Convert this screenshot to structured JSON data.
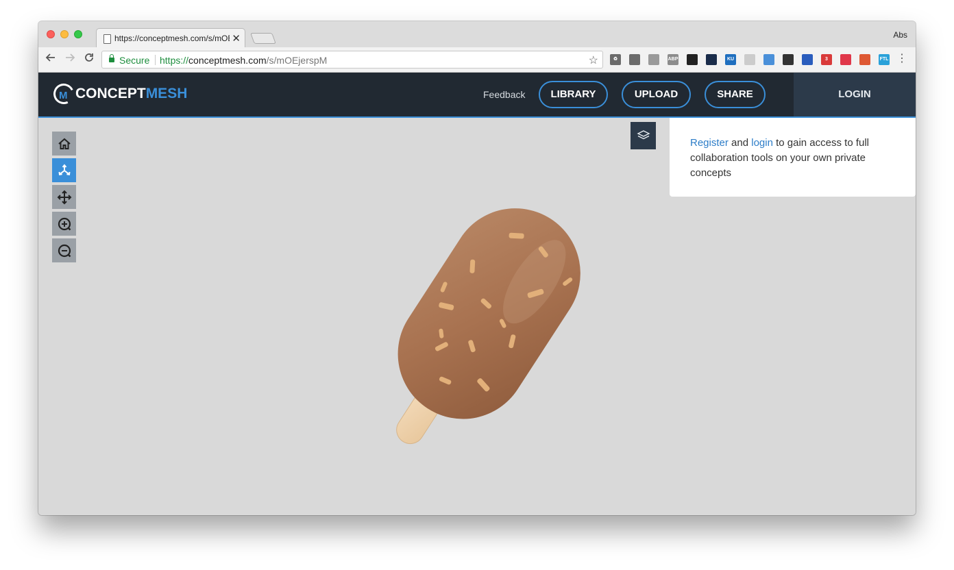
{
  "browser": {
    "tab_title": "https://conceptmesh.com/s/mOEjerspM",
    "tab_close": "✕",
    "profile_name": "Abs",
    "secure_label": "Secure",
    "url": {
      "scheme": "https://",
      "host": "conceptmesh.com",
      "path": "/s/mOEjerspM"
    },
    "extensions": [
      {
        "icon": "recycle-icon",
        "color": "#6b6b6b",
        "text": "♻"
      },
      {
        "icon": "cast-icon",
        "color": "#6b6b6b",
        "text": ""
      },
      {
        "icon": "puzzle-icon",
        "color": "#9a9a9a",
        "text": ""
      },
      {
        "icon": "adblock-icon",
        "color": "#8c8c8c",
        "text": "ABP"
      },
      {
        "icon": "pin-icon",
        "color": "#222222",
        "text": ""
      },
      {
        "icon": "tree-icon",
        "color": "#1a2c4a",
        "text": ""
      },
      {
        "icon": "ku-icon",
        "color": "#1f6fbf",
        "text": "KU"
      },
      {
        "icon": "moon-icon",
        "color": "#cccccc",
        "text": ""
      },
      {
        "icon": "frame-icon",
        "color": "#4a90d9",
        "text": ""
      },
      {
        "icon": "film-icon",
        "color": "#333333",
        "text": ""
      },
      {
        "icon": "block-icon",
        "color": "#2a5dbd",
        "text": ""
      },
      {
        "icon": "calendar-icon",
        "color": "#d93a3a",
        "text": "3"
      },
      {
        "icon": "pocket-icon",
        "color": "#e0374a",
        "text": ""
      },
      {
        "icon": "duckduckgo-icon",
        "color": "#de5833",
        "text": ""
      },
      {
        "icon": "ftl-icon",
        "color": "#2aa1d9",
        "text": "FTL"
      }
    ]
  },
  "site": {
    "logo_part1": "CONCEPT",
    "logo_part2": "MESH",
    "logo_letter": "M",
    "nav": {
      "feedback": "Feedback",
      "library": "LIBRARY",
      "upload": "UPLOAD",
      "share": "SHARE",
      "login": "LOGIN"
    },
    "accent_color": "#3a8fd9",
    "header_color": "#212932"
  },
  "viewer": {
    "tools": [
      {
        "name": "home-tool",
        "icon": "home-icon",
        "active": false
      },
      {
        "name": "rotate-tool",
        "icon": "rotate-icon",
        "active": true
      },
      {
        "name": "pan-tool",
        "icon": "move-icon",
        "active": false
      },
      {
        "name": "zoom-in-tool",
        "icon": "zoom-in-icon",
        "active": false
      },
      {
        "name": "zoom-out-tool",
        "icon": "zoom-out-icon",
        "active": false
      }
    ],
    "layers_icon": "layers-icon",
    "model_subject": "ice-cream-bar-model"
  },
  "login_panel": {
    "register_link": "Register",
    "and_text": " and ",
    "login_link": "login",
    "message": " to gain access to full collaboration tools on your own private concepts"
  }
}
